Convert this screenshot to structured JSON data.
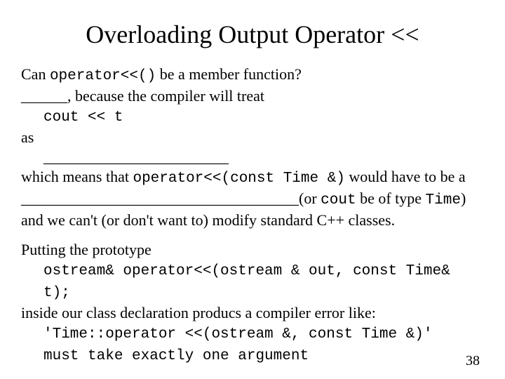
{
  "title": "Overloading Output Operator <<",
  "line1_a": "Can ",
  "line1_code": "operator<<()",
  "line1_b": " be a member function?",
  "line2": "______, because the compiler will treat",
  "line3_code": "cout << t",
  "line4": "as",
  "line5": "________________________",
  "line6_a": "which means that ",
  "line6_code": "operator<<(const Time &)",
  "line6_b": " would have to be a",
  "line7_a": "____________________________________(or ",
  "line7_code1": "cout",
  "line7_b": " be of type ",
  "line7_code2": "Time",
  "line7_c": ")",
  "line8": "and we can't (or don't want to) modify standard C++ classes.",
  "line9": "Putting the prototype",
  "line10_code": "ostream& operator<<(ostream & out, const Time& t);",
  "line11": "inside our class declaration producs a compiler error like:",
  "line12_code": "'Time::operator <<(ostream &, const Time &)'",
  "line13_code": "must take exactly one argument",
  "pagenum": "38"
}
